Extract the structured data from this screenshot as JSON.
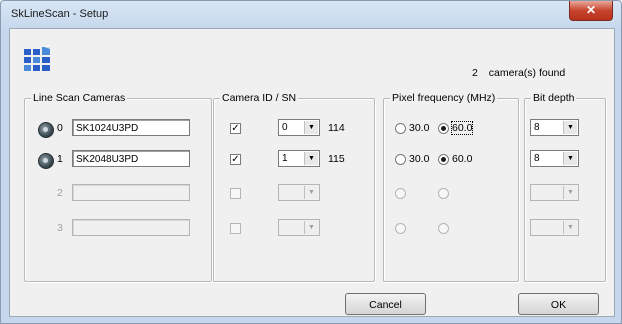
{
  "window": {
    "title": "SkLineScan - Setup",
    "close_label": "✕"
  },
  "header": {
    "camera_count": "2",
    "found_label": "camera(s) found"
  },
  "groups": {
    "cameras": "Line Scan Cameras",
    "camera_id": "Camera ID / SN",
    "pixel_freq": "Pixel frequency (MHz)",
    "bit_depth": "Bit depth"
  },
  "rows": [
    {
      "index": "0",
      "name": "SK1024U3PD",
      "checked": "✓",
      "id": "0",
      "sn": "114",
      "freq_a": "30.0",
      "freq_b": "60.0",
      "bit": "8"
    },
    {
      "index": "1",
      "name": "SK2048U3PD",
      "checked": "✓",
      "id": "1",
      "sn": "115",
      "freq_a": "30.0",
      "freq_b": "60.0",
      "bit": "8"
    },
    {
      "index": "2",
      "name": "",
      "checked": "",
      "id": "",
      "sn": "",
      "freq_a": "",
      "freq_b": "",
      "bit": ""
    },
    {
      "index": "3",
      "name": "",
      "checked": "",
      "id": "",
      "sn": "",
      "freq_a": "",
      "freq_b": "",
      "bit": ""
    }
  ],
  "buttons": {
    "cancel": "Cancel",
    "ok": "OK"
  },
  "icons": {
    "combo_arrow": "▼",
    "logo": "grid-logo-icon",
    "camera": "camera-lens-icon"
  },
  "colors": {
    "logo_blue": "#2a5ec9"
  }
}
